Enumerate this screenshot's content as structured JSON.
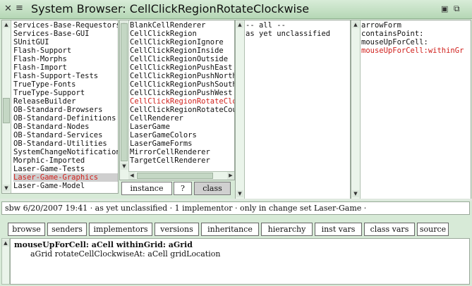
{
  "window": {
    "title": "System Browser: CellClickRegionRotateClockwise",
    "close_icon": "✕",
    "menu_icon": "≡",
    "collapse_icon": "▣",
    "expand_icon": "⧉"
  },
  "categories": {
    "items": [
      "Services-Base-Requestors",
      "Services-Base-GUI",
      "SUnitGUI",
      "Flash-Support",
      "Flash-Morphs",
      "Flash-Import",
      "Flash-Support-Tests",
      "TrueType-Fonts",
      "TrueType-Support",
      "ReleaseBuilder",
      "OB-Standard-Browsers",
      "OB-Standard-Definitions",
      "OB-Standard-Nodes",
      "OB-Standard-Services",
      "OB-Standard-Utilities",
      "SystemChangeNotification",
      "Morphic-Imported",
      "Laser-Game-Tests",
      "Laser-Game-Graphics",
      "Laser-Game-Model"
    ],
    "selected_index": 18
  },
  "classes": {
    "items": [
      "BlankCellRenderer",
      "CellClickRegion",
      "CellClickRegionIgnore",
      "CellClickRegionInside",
      "CellClickRegionOutside",
      "CellClickRegionPushEast",
      "CellClickRegionPushNorth",
      "CellClickRegionPushSouth",
      "CellClickRegionPushWest",
      "CellClickRegionRotateClock",
      "CellClickRegionRotateCoun",
      "CellRenderer",
      "LaserGame",
      "LaserGameColors",
      "LaserGameForms",
      "MirrorCellRenderer",
      "TargetCellRenderer"
    ],
    "selected_index": 9
  },
  "protocols": {
    "items": [
      "-- all --",
      "as yet unclassified"
    ]
  },
  "methods": {
    "items": [
      "arrowForm",
      "containsPoint:",
      "mouseUpForCell:",
      "mouseUpForCell:withinGr"
    ],
    "selected_index": 3
  },
  "class_side": {
    "instance_label": "instance",
    "help_label": "?",
    "class_label": "class",
    "selected": "class"
  },
  "info_line": "sbw 6/20/2007 19:41 · as yet unclassified · 1 implementor · only in change set Laser-Game  ·",
  "buttons": [
    "browse",
    "senders",
    "implementors",
    "versions",
    "inheritance",
    "hierarchy",
    "inst vars",
    "class vars",
    "source"
  ],
  "code": {
    "line1": "mouseUpForCell: aCell withinGrid: aGrid",
    "line2": "aGrid rotateCellClockwiseAt: aCell gridLocation"
  },
  "colors": {
    "accent_selected_text": "#d0201c",
    "window_background": "#d7ead7"
  }
}
